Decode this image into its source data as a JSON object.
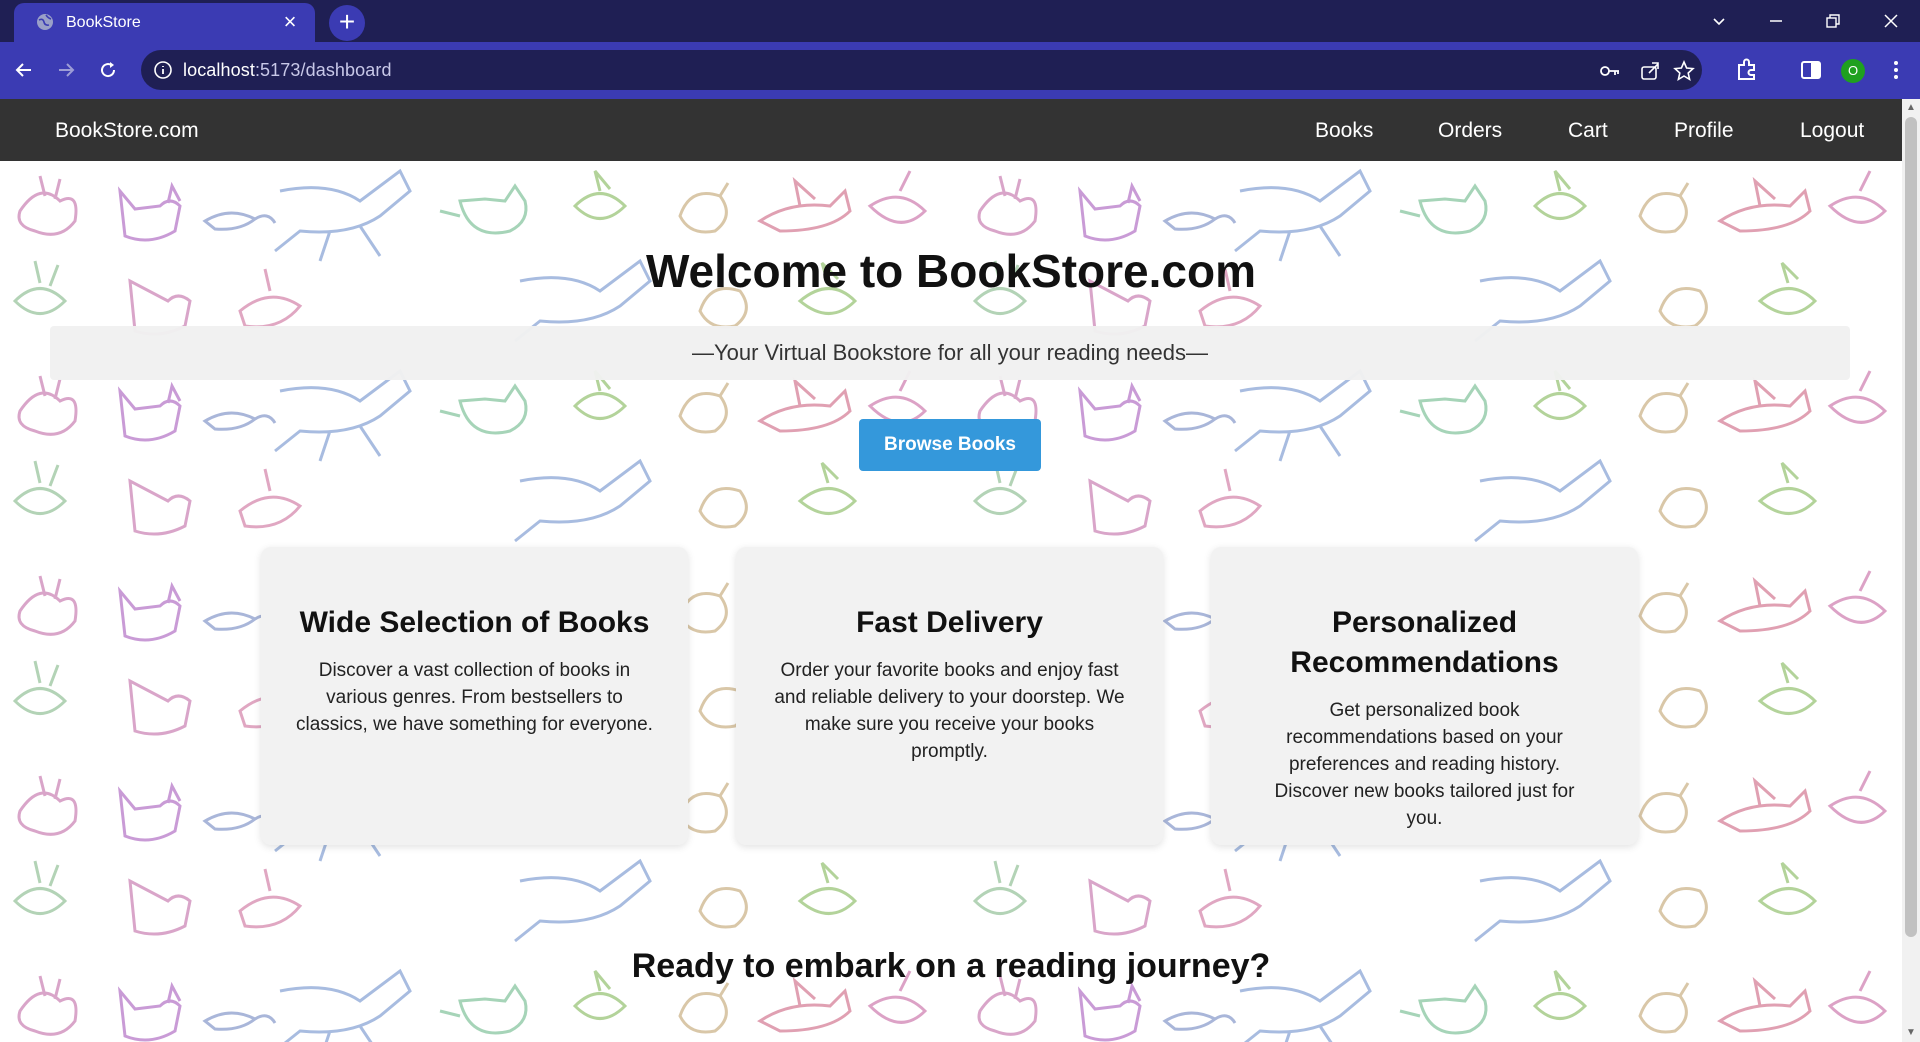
{
  "browser": {
    "tab_title": "BookStore",
    "url_host": "localhost",
    "url_path": ":5173/dashboard",
    "profile_initial": "O"
  },
  "nav": {
    "brand": "BookStore.com",
    "links": [
      "Books",
      "Orders",
      "Cart",
      "Profile",
      "Logout"
    ]
  },
  "hero": {
    "title": "Welcome to BookStore.com",
    "tagline": "—Your Virtual Bookstore for all your reading needs—",
    "button": "Browse Books"
  },
  "features": [
    {
      "title": "Wide Selection of Books",
      "text": "Discover a vast collection of books in various genres. From bestsellers to classics, we have something for everyone."
    },
    {
      "title": "Fast Delivery",
      "text": "Order your favorite books and enjoy fast and reliable delivery to your doorstep. We make sure you receive your books promptly."
    },
    {
      "title": "Personalized Recommendations",
      "text": "Get personalized book recommendations based on your preferences and reading history. Discover new books tailored just for you."
    }
  ],
  "cta": {
    "title": "Ready to embark on a reading journey?"
  },
  "colors": {
    "tabbar": "#1f1f54",
    "toolbar": "#3b3bb3",
    "site_nav": "#333333",
    "accent": "#3498db"
  }
}
